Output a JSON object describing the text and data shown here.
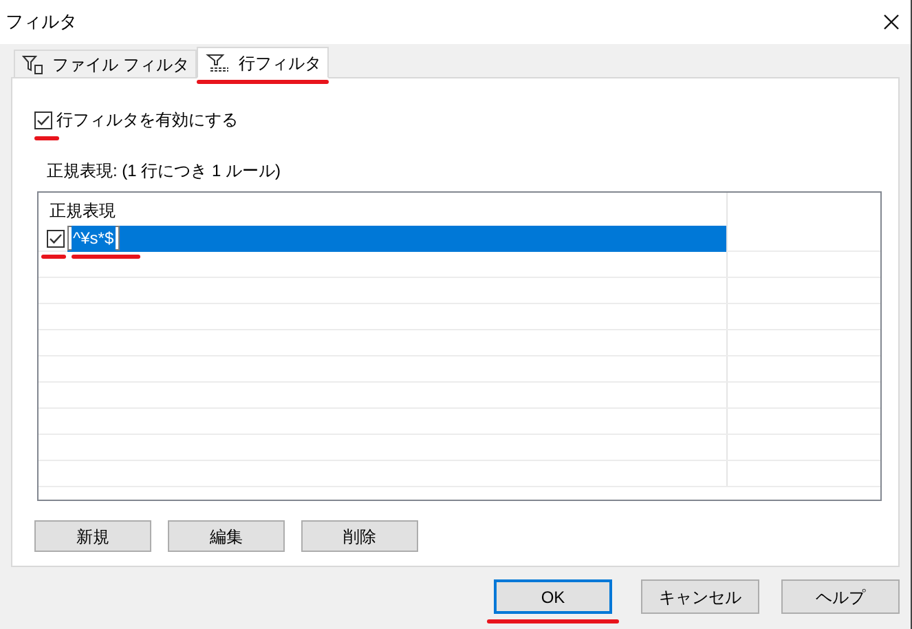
{
  "window": {
    "title": "フィルタ"
  },
  "tabs": [
    {
      "label": "ファイル フィルタ",
      "kind": "file",
      "selected": false
    },
    {
      "label": "行フィルタ",
      "kind": "row",
      "selected": true
    }
  ],
  "enable_checkbox": {
    "label": "行フィルタを有効にする",
    "checked": true
  },
  "section_label": "正規表現: (1 行につき 1 ルール)",
  "table": {
    "columns": [
      "正規表現"
    ],
    "rows": [
      {
        "checked": true,
        "value": "^¥s*$",
        "selected": true
      }
    ]
  },
  "list_buttons": [
    "新規",
    "編集",
    "削除"
  ],
  "dialog_buttons": [
    {
      "label": "OK",
      "focused": true
    },
    {
      "label": "キャンセル",
      "focused": false
    },
    {
      "label": "ヘルプ",
      "focused": false
    }
  ]
}
